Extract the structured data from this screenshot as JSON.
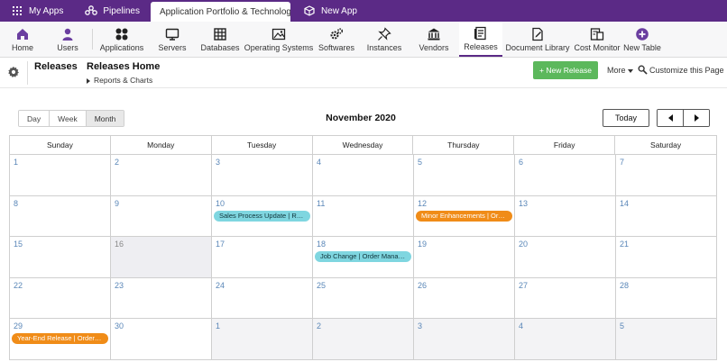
{
  "apptabs": [
    {
      "label": "My Apps",
      "icon": "grid-icon"
    },
    {
      "label": "Pipelines",
      "icon": "pipeline-icon"
    },
    {
      "label": "Application Portfolio & Technology...",
      "icon": ""
    },
    {
      "label": "New App",
      "icon": "new-app-icon"
    }
  ],
  "toolbar": [
    {
      "label": "Home",
      "icon": "home-icon"
    },
    {
      "label": "Users",
      "icon": "user-icon"
    },
    {
      "label": "Applications",
      "icon": "applications-icon"
    },
    {
      "label": "Servers",
      "icon": "server-icon"
    },
    {
      "label": "Databases",
      "icon": "database-icon"
    },
    {
      "label": "Operating Systems",
      "icon": "image-icon"
    },
    {
      "label": "Softwares",
      "icon": "gears-icon"
    },
    {
      "label": "Instances",
      "icon": "pin-icon"
    },
    {
      "label": "Vendors",
      "icon": "bank-icon"
    },
    {
      "label": "Releases",
      "icon": "releases-icon"
    },
    {
      "label": "Document Library",
      "icon": "document-icon"
    },
    {
      "label": "Cost Monitor",
      "icon": "cost-monitor-icon"
    },
    {
      "label": "New Table",
      "icon": "plus-circle-icon"
    }
  ],
  "header": {
    "title": "Releases",
    "subtitle": "Releases Home",
    "breadcrumb": "Reports & Charts",
    "new_button": "+ New Release",
    "more": "More",
    "customize": "Customize this Page"
  },
  "calendar": {
    "views": [
      "Day",
      "Week",
      "Month"
    ],
    "active_view": "Month",
    "title": "November 2020",
    "today_label": "Today",
    "weekdays": [
      "Sunday",
      "Monday",
      "Tuesday",
      "Wednesday",
      "Thursday",
      "Friday",
      "Saturday"
    ],
    "weeks": [
      [
        "1",
        "2",
        "3",
        "4",
        "5",
        "6",
        "7"
      ],
      [
        "8",
        "9",
        "10",
        "11",
        "12",
        "13",
        "14"
      ],
      [
        "15",
        "16",
        "17",
        "18",
        "19",
        "20",
        "21"
      ],
      [
        "22",
        "23",
        "24",
        "25",
        "26",
        "27",
        "28"
      ],
      [
        "29",
        "30",
        "1",
        "2",
        "3",
        "4",
        "5"
      ]
    ],
    "today": {
      "week": 2,
      "day": 1
    },
    "events": [
      {
        "week": 1,
        "day": 2,
        "label": "Sales Process Update | Rou...",
        "color": "#7fd6e0"
      },
      {
        "week": 1,
        "day": 4,
        "label": "Minor Enhancements | Ord...",
        "color": "#f08c18"
      },
      {
        "week": 2,
        "day": 3,
        "label": "Job Change | Order Manag...",
        "color": "#7fd6e0"
      },
      {
        "week": 4,
        "day": 0,
        "label": "Year-End Release | Order M...",
        "color": "#f08c18"
      }
    ]
  },
  "colors": {
    "brand": "#5b2a86",
    "new_button": "#5cb85c",
    "link": "#5a87b8"
  }
}
